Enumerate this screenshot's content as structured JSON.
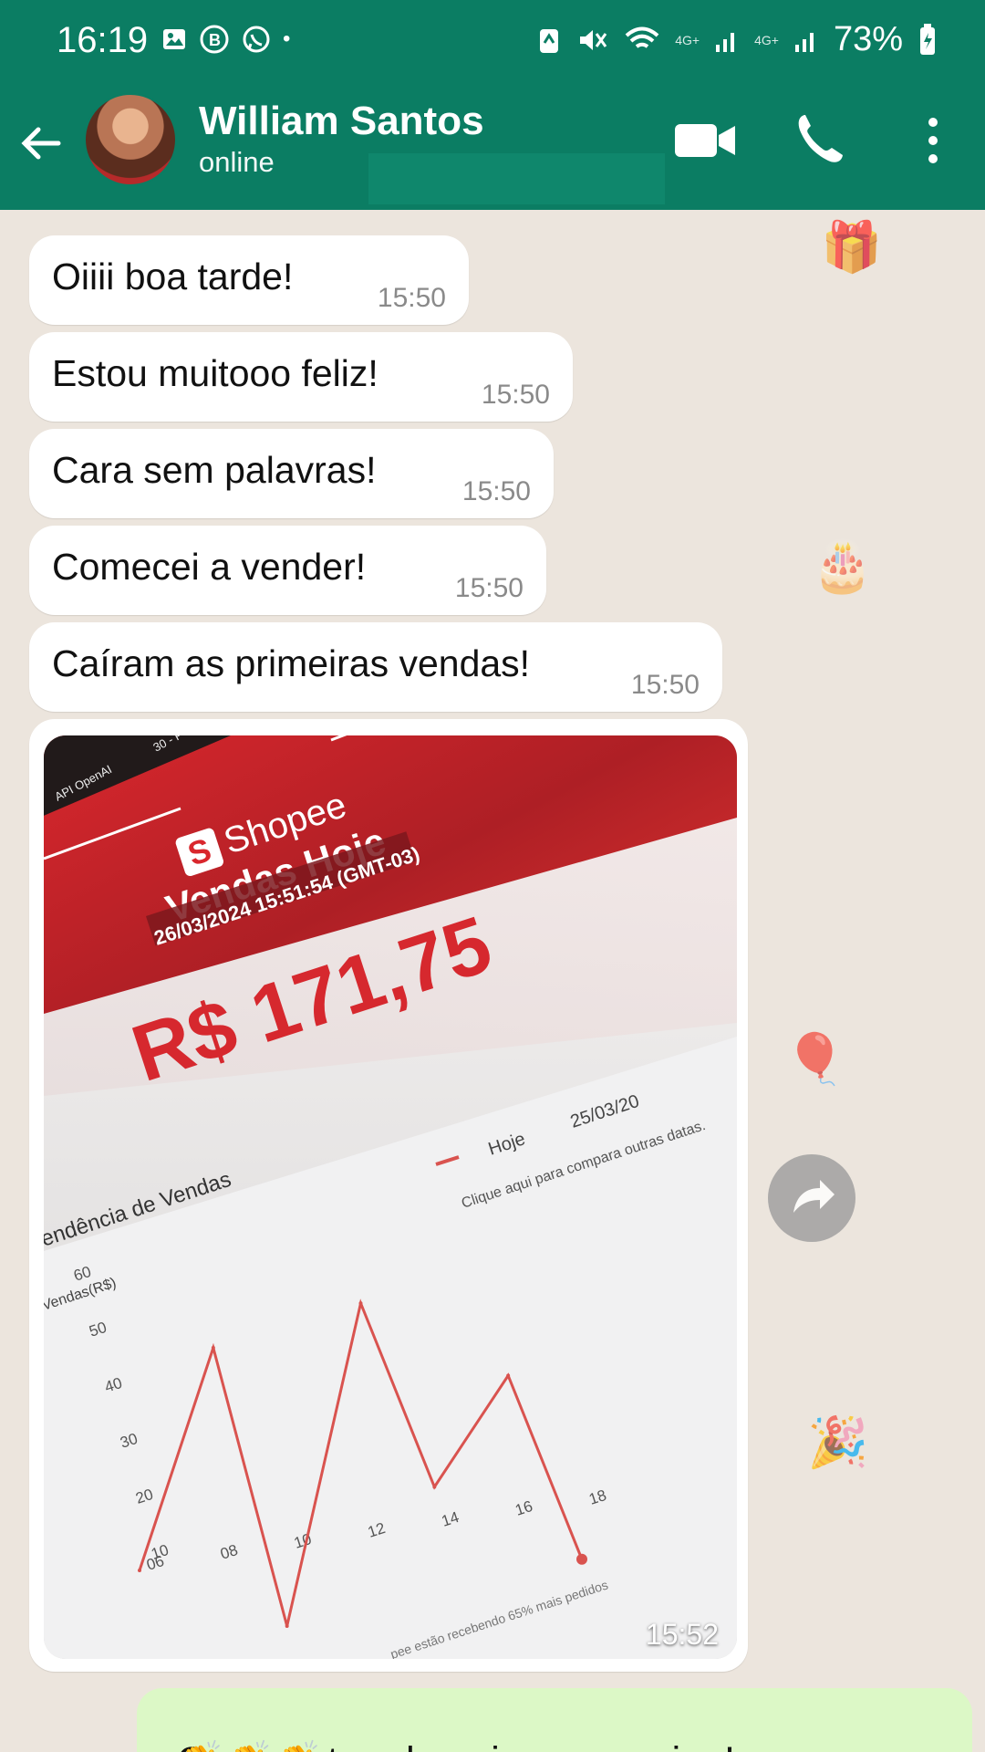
{
  "status_bar": {
    "time": "16:19",
    "network1": "4G+",
    "network2": "4G+",
    "battery": "73%"
  },
  "header": {
    "contact_name": "William Santos",
    "contact_status": "online"
  },
  "messages": [
    {
      "text": "Oiiii boa tarde!",
      "time": "15:50"
    },
    {
      "text": "Estou muitooo feliz!",
      "time": "15:50"
    },
    {
      "text": "Cara sem palavras!",
      "time": "15:50"
    },
    {
      "text": "Comecei a vender!",
      "time": "15:50"
    },
    {
      "text": "Caíram as primeiras vendas!",
      "time": "15:50"
    }
  ],
  "image_message": {
    "time": "15:52",
    "shopee": {
      "logo": "Shopee",
      "logo_letter": "S",
      "small_header": "API OpenAI",
      "small_header2": "30 - P",
      "title": "Vendas Hoje",
      "timestamp": "26/03/2024 15:51:54 (GMT-03)",
      "amount": "R$ 171,75",
      "legend_today": "Hoje",
      "legend_compare": "25/03/20",
      "compare_note": "Clique aqui para compara outras datas.",
      "trend_label": "endência de Vendas",
      "y_label": "Vendas(R$)",
      "footnote": "pee estão recebendo 65% mais pedidos"
    },
    "chart_data": {
      "type": "line",
      "title": "endência de Vendas",
      "ylabel": "Vendas(R$)",
      "x": [
        "06",
        "08",
        "10",
        "12",
        "14",
        "16",
        "18"
      ],
      "y_ticks": [
        60,
        50,
        40,
        30,
        20,
        10
      ],
      "series": [
        {
          "name": "Hoje",
          "values": [
            10,
            50,
            0,
            58,
            25,
            45,
            12
          ]
        }
      ],
      "ylim": [
        10,
        60
      ],
      "colors": {
        "line": "#d9534f"
      }
    }
  },
  "outgoing": {
    "text": "Opaaaa top demais meu amigo!",
    "emoji": "👏👏👏"
  }
}
